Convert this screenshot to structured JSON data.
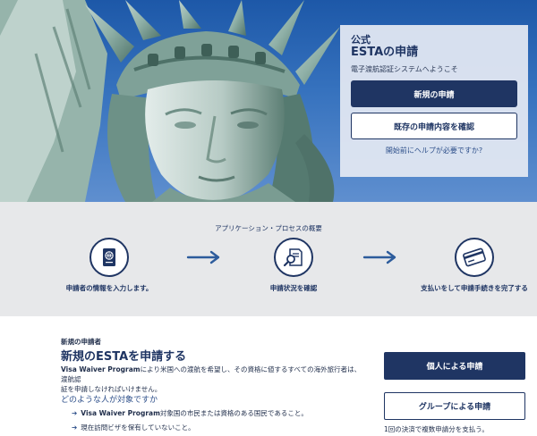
{
  "hero": {
    "card": {
      "kicker": "公式",
      "title": "ESTAの申請",
      "welcome": "電子渡航認証システムへようこそ",
      "new_application": "新規の申請",
      "check_existing": "既存の申請内容を確認",
      "help_link": "開始前にヘルプが必要ですか?"
    }
  },
  "process": {
    "title": "アプリケーション・プロセスの概要",
    "steps": [
      {
        "icon": "passport-icon",
        "label": "申請者の情報を入力します。"
      },
      {
        "icon": "document-search-icon",
        "label": "申請状況を確認"
      },
      {
        "icon": "credit-card-icon",
        "label": "支払いをして申請手続きを完了する"
      }
    ]
  },
  "new_section": {
    "label": "新規の申請者",
    "title": "新規のESTAを申請する",
    "intro_bold": "Visa Waiver Program",
    "intro_rest_line1": "により米国への渡航を希望し、その資格に値するすべての海外旅行者は、渡航認",
    "intro_line2": "証を申請しなければいけません。",
    "who_heading": "どのような人が対象ですか",
    "bullets": [
      {
        "bold": "Visa Waiver Program",
        "text": "対象国の市民または資格のある国民であること。"
      },
      {
        "bold": "",
        "text": "現在訪問ビザを保有していないこと。"
      }
    ],
    "individual_button": "個人による申請",
    "group_button": "グループによる申請",
    "group_note": "1回の決済で複数申請分を支払う。"
  },
  "colors": {
    "navy": "#1f3563",
    "link": "#2d4f8a",
    "process_bg": "#e7e8ea",
    "sky": "#3672be"
  }
}
